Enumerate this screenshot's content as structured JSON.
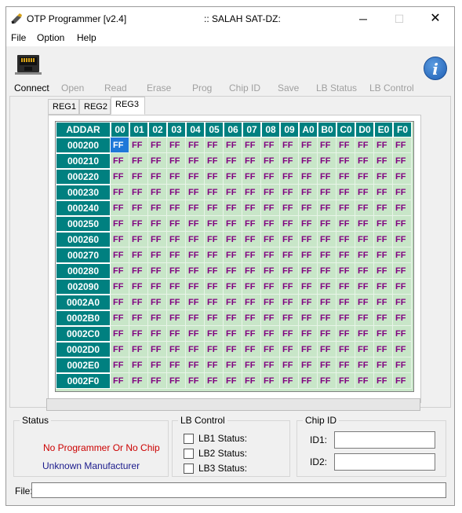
{
  "window": {
    "title": "OTP Programmer [v2.4]",
    "center_title": ":: SALAH SAT-DZ:",
    "minimize": "─",
    "maximize": "☐",
    "close": "✕"
  },
  "menu": [
    "File",
    "Option",
    "Help"
  ],
  "toolbar": {
    "connect": "Connect",
    "open": "Open",
    "read": "Read",
    "erase": "Erase",
    "prog": "Prog",
    "chip_id": "Chip ID",
    "save": "Save",
    "lb_status": "LB Status",
    "lb_control": "LB Control",
    "info": "i"
  },
  "tabs": [
    "REG1",
    "REG2",
    "REG3"
  ],
  "active_tab": "REG3",
  "grid": {
    "corner": "ADDAR",
    "columns": [
      "00",
      "01",
      "02",
      "03",
      "04",
      "05",
      "06",
      "07",
      "08",
      "09",
      "A0",
      "B0",
      "C0",
      "D0",
      "E0",
      "F0"
    ],
    "rows": [
      "000200",
      "000210",
      "000220",
      "000230",
      "000240",
      "000250",
      "000260",
      "000270",
      "000280",
      "002090",
      "0002A0",
      "0002B0",
      "0002C0",
      "0002D0",
      "0002E0",
      "0002F0"
    ],
    "cell_value": "FF",
    "selected_cell": [
      0,
      0
    ]
  },
  "status": {
    "title": "Status",
    "line1": "No Programmer Or No Chip",
    "line2": "Unknown Manufacturer",
    "line1_color": "#cc0000",
    "line2_color": "#1a1a8c"
  },
  "lb_control": {
    "title": "LB Control",
    "items": [
      "LB1 Status:",
      "LB2 Status:",
      "LB3 Status:"
    ]
  },
  "chip_id": {
    "title": "Chip ID",
    "id1_label": "ID1:",
    "id2_label": "ID2:",
    "id1_value": "",
    "id2_value": ""
  },
  "file": {
    "label": "File:",
    "value": ""
  },
  "colors": {
    "grid_header": "#008080",
    "grid_bg": "#c8e6c8",
    "cell_text": "#800080",
    "selection": "#1e78d8"
  }
}
